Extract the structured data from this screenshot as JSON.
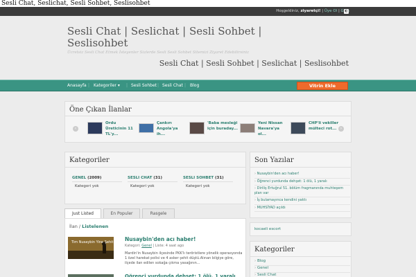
{
  "page_title": "Sesli Chat, Seslichat, Sesli Sohbet, Seslisohbet",
  "topbar": {
    "welcome": "Hoşgeldiniz,",
    "user": "ziyaretçi!",
    "signup": "Üye Ol",
    "login": "Giriş",
    "separator": "|",
    "rss_glyph": "◐"
  },
  "header": {
    "site_title": "Sesli Chat | Seslichat | Sesli Sohbet | Seslisohbet",
    "tagline": "Ücretsiz Sesli Chat Etmek İsteyenler Sizlerde Sesli Sesli Sohbet Sitemizi Ziyaret Edebilirsiniz",
    "banner": "Sesli Chat | Sesli Sohbet | Seslichat | Seslisohbet"
  },
  "nav": {
    "items": [
      "Anasayfa",
      "Kategoriler ▾",
      "Sesli Sohbet",
      "Sesli Chat",
      "Blog"
    ],
    "cta": "Vitrin Ekle"
  },
  "featured": {
    "title": "Öne Çıkan İlanlar",
    "items": [
      {
        "title": "Ordu Üreticinin 11 TL'y..."
      },
      {
        "title": "Çankırı Angola'ya ih..."
      },
      {
        "title": "'Baba mesleği için buraday..."
      },
      {
        "title": "Yeni Nissan Navara'ya ol..."
      },
      {
        "title": "CHP'li vekiller mülteci rot..."
      }
    ],
    "prev": "‹",
    "next": "›"
  },
  "categories": {
    "title": "Kategoriler",
    "columns": [
      {
        "name": "GENEL",
        "count": "(2009)",
        "sub": "Kategori yok"
      },
      {
        "name": "SESLI CHAT",
        "count": "(31)",
        "sub": "Kategori yok"
      },
      {
        "name": "SESLI SOHBET",
        "count": "(31)",
        "sub": "Kategori yok"
      }
    ]
  },
  "tabs": {
    "items": [
      "Just Listed",
      "En Populer",
      "Rasgele"
    ],
    "active": 0
  },
  "listing": {
    "crumb_prefix": "İlan /",
    "crumb_current": "Listelenen",
    "post": {
      "thumb_caption": "Tim Nusaybin Yine Şehit",
      "title": "Nusaybin'den acı haber!",
      "meta_prefix": "Kategori:",
      "meta_cat": "Genel",
      "meta_suffix": "| Liste: 4 saat ago",
      "excerpt": "Mardin'in Nusaybin ilçesinde PKK'lı teröristlere yönelik operasyonda 1 özel harekat polisi ve 4 asker şehit düştü.Alınan bilgiye göre, ilçede ilan edilen sokağa çıkma yasağının..."
    },
    "post2": {
      "title": "Öğrenci yurdunda dehşet: 1 ölü, 1 yaralı"
    }
  },
  "recent": {
    "title": "Son Yazılar",
    "bullet": "›",
    "items": [
      "Nusaybin'den acı haber!",
      "Öğrenci yurdunda dehşet: 1 ölü, 1 yaralı",
      "Diriliş Ertuğrul 51. bölüm fragmanında muhteşem plan var",
      "İş bulamayınca kendini yaktı",
      "MUHSİYAD açıldı"
    ]
  },
  "sidebar_link": "kocaeli escort",
  "sidebar_categories": {
    "title": "Kategoriler",
    "bullet": "›",
    "items": [
      "Blog",
      "Genel",
      "Sesli Chat"
    ]
  },
  "colors": {
    "accent": "#3a9483",
    "link": "#2a7e6f",
    "cta": "#ef6a2b",
    "topbar": "#3b3b3b"
  }
}
